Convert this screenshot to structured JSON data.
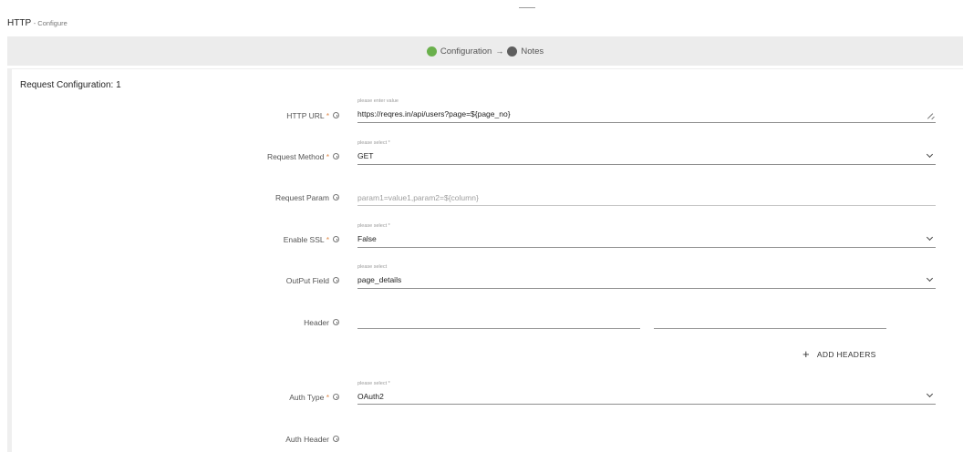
{
  "header": {
    "title": "HTTP",
    "subtitle": "- Configure"
  },
  "stepper": {
    "step1": "Configuration",
    "arrow": "→",
    "step2": "Notes",
    "step1_color": "#6ab04c",
    "step2_color": "#5e5e5e"
  },
  "section": {
    "title": "Request Configuration: 1"
  },
  "fields": {
    "http_url": {
      "label": "HTTP URL",
      "required": "*",
      "hint": "please enter value",
      "value": "https://reqres.in/api/users?page=${page_no}"
    },
    "request_method": {
      "label": "Request Method",
      "required": "*",
      "hint": "please select *",
      "value": "GET"
    },
    "request_param": {
      "label": "Request Param",
      "placeholder": "param1=value1,param2=${column}"
    },
    "enable_ssl": {
      "label": "Enable SSL",
      "required": "*",
      "hint": "please select *",
      "value": "False"
    },
    "output_field": {
      "label": "OutPut Field",
      "hint": "please select",
      "value": "page_details"
    },
    "header": {
      "label": "Header"
    },
    "add_headers": {
      "label": "ADD HEADERS",
      "icon": "plus-icon"
    },
    "auth_type": {
      "label": "Auth Type",
      "required": "*",
      "hint": "please select *",
      "value": "OAuth2"
    },
    "auth_header": {
      "label": "Auth Header"
    }
  }
}
